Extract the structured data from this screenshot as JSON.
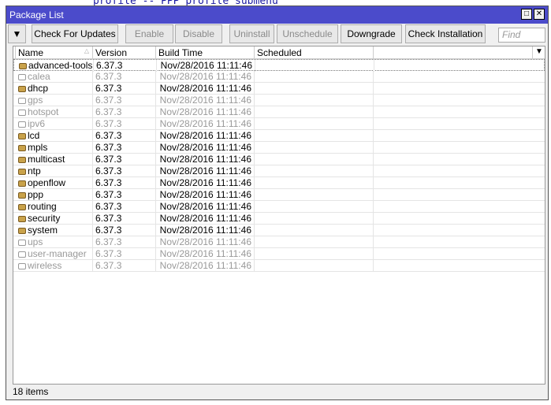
{
  "background_text": "profile -- PPP profile submenu",
  "window": {
    "title": "Package List"
  },
  "toolbar": {
    "filter": "filter-icon",
    "buttons": [
      {
        "label": "Check For Updates",
        "enabled": true
      },
      {
        "label": "Enable",
        "enabled": false
      },
      {
        "label": "Disable",
        "enabled": false
      },
      {
        "label": "Uninstall",
        "enabled": false
      },
      {
        "label": "Unschedule",
        "enabled": false
      },
      {
        "label": "Downgrade",
        "enabled": true
      },
      {
        "label": "Check Installation",
        "enabled": true
      }
    ],
    "find_placeholder": "Find"
  },
  "columns": [
    "Name",
    "Version",
    "Build Time",
    "Scheduled"
  ],
  "rows": [
    {
      "name": "advanced-tools",
      "version": "6.37.3",
      "build": "Nov/28/2016 11:11:46",
      "scheduled": "",
      "enabled": true
    },
    {
      "name": "calea",
      "version": "6.37.3",
      "build": "Nov/28/2016 11:11:46",
      "scheduled": "",
      "enabled": false
    },
    {
      "name": "dhcp",
      "version": "6.37.3",
      "build": "Nov/28/2016 11:11:46",
      "scheduled": "",
      "enabled": true
    },
    {
      "name": "gps",
      "version": "6.37.3",
      "build": "Nov/28/2016 11:11:46",
      "scheduled": "",
      "enabled": false
    },
    {
      "name": "hotspot",
      "version": "6.37.3",
      "build": "Nov/28/2016 11:11:46",
      "scheduled": "",
      "enabled": false
    },
    {
      "name": "ipv6",
      "version": "6.37.3",
      "build": "Nov/28/2016 11:11:46",
      "scheduled": "",
      "enabled": false
    },
    {
      "name": "lcd",
      "version": "6.37.3",
      "build": "Nov/28/2016 11:11:46",
      "scheduled": "",
      "enabled": true
    },
    {
      "name": "mpls",
      "version": "6.37.3",
      "build": "Nov/28/2016 11:11:46",
      "scheduled": "",
      "enabled": true
    },
    {
      "name": "multicast",
      "version": "6.37.3",
      "build": "Nov/28/2016 11:11:46",
      "scheduled": "",
      "enabled": true
    },
    {
      "name": "ntp",
      "version": "6.37.3",
      "build": "Nov/28/2016 11:11:46",
      "scheduled": "",
      "enabled": true
    },
    {
      "name": "openflow",
      "version": "6.37.3",
      "build": "Nov/28/2016 11:11:46",
      "scheduled": "",
      "enabled": true
    },
    {
      "name": "ppp",
      "version": "6.37.3",
      "build": "Nov/28/2016 11:11:46",
      "scheduled": "",
      "enabled": true
    },
    {
      "name": "routing",
      "version": "6.37.3",
      "build": "Nov/28/2016 11:11:46",
      "scheduled": "",
      "enabled": true
    },
    {
      "name": "security",
      "version": "6.37.3",
      "build": "Nov/28/2016 11:11:46",
      "scheduled": "",
      "enabled": true
    },
    {
      "name": "system",
      "version": "6.37.3",
      "build": "Nov/28/2016 11:11:46",
      "scheduled": "",
      "enabled": true
    },
    {
      "name": "ups",
      "version": "6.37.3",
      "build": "Nov/28/2016 11:11:46",
      "scheduled": "",
      "enabled": false
    },
    {
      "name": "user-manager",
      "version": "6.37.3",
      "build": "Nov/28/2016 11:11:46",
      "scheduled": "",
      "enabled": false
    },
    {
      "name": "wireless",
      "version": "6.37.3",
      "build": "Nov/28/2016 11:11:46",
      "scheduled": "",
      "enabled": false
    }
  ],
  "status": "18 items"
}
